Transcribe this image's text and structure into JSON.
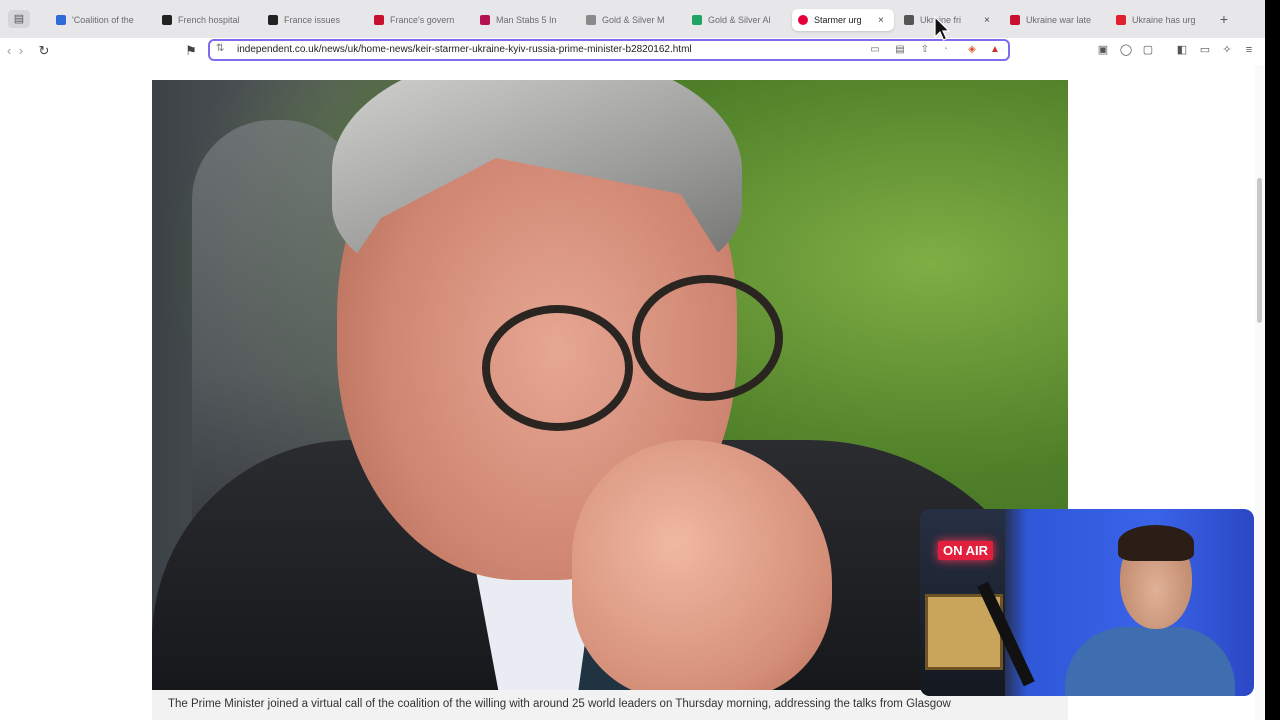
{
  "browser": {
    "tabs": [
      {
        "title": "'Coalition of the",
        "favicon_color": "#2f6bd6",
        "active": false
      },
      {
        "title": "French hospital",
        "favicon_color": "#222222",
        "active": false
      },
      {
        "title": "France issues",
        "favicon_color": "#222222",
        "active": false
      },
      {
        "title": "France's govern",
        "favicon_color": "#c8102e",
        "active": false
      },
      {
        "title": "Man Stabs 5 In",
        "favicon_color": "#b3124f",
        "active": false
      },
      {
        "title": "Gold & Silver M",
        "favicon_color": "#8a8a8a",
        "active": false
      },
      {
        "title": "Gold & Silver Al",
        "favicon_color": "#1fa463",
        "active": false
      },
      {
        "title": "Starmer urg",
        "favicon_color": "#e4003b",
        "active": true
      },
      {
        "title": "Ukraine fri",
        "favicon_color": "#555555",
        "active": false
      },
      {
        "title": "Ukraine war late",
        "favicon_color": "#c8102e",
        "active": false
      },
      {
        "title": "Ukraine has urg",
        "favicon_color": "#e0202f",
        "active": false
      }
    ],
    "tab_close_glyph": "×",
    "new_tab_glyph": "+",
    "url": "independent.co.uk/news/uk/home-news/keir-starmer-ukraine-kyiv-russia-prime-minister-b2820162.html"
  },
  "article": {
    "caption": "The Prime Minister joined a virtual call of the coalition of the willing with around 25 world leaders on Thursday morning, addressing the talks from Glasgow"
  },
  "overlay": {
    "on_air_label": "ON AIR"
  },
  "colors": {
    "address_focus": "#7b6cf0",
    "active_tab": "#ffffff",
    "on_air": "#e21f3c"
  }
}
